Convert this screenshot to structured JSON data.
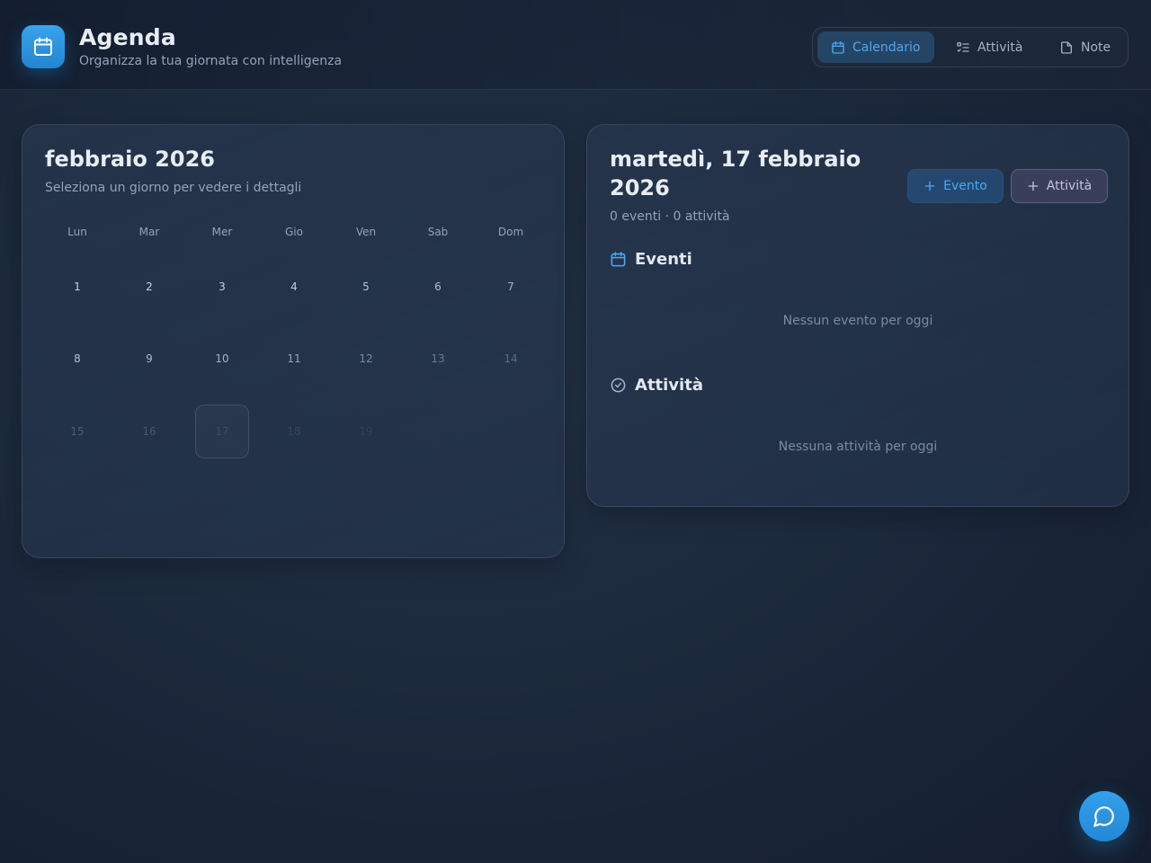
{
  "header": {
    "title": "Agenda",
    "subtitle": "Organizza la tua giornata con intelligenza",
    "icon": "calendar-icon"
  },
  "nav": {
    "tabs": [
      {
        "label": "Calendario",
        "icon": "calendar-icon",
        "active": true
      },
      {
        "label": "Attività",
        "icon": "list-check-icon",
        "active": false
      },
      {
        "label": "Note",
        "icon": "note-icon",
        "active": false
      }
    ]
  },
  "calendar": {
    "month_title": "febbraio 2026",
    "subtitle": "Seleziona un giorno per vedere i dettagli",
    "weekdays": [
      "Lun",
      "Mar",
      "Mer",
      "Gio",
      "Ven",
      "Sab",
      "Dom"
    ],
    "days": [
      "1",
      "2",
      "3",
      "4",
      "5",
      "6",
      "7",
      "8",
      "9",
      "10",
      "11",
      "12",
      "13",
      "14",
      "15",
      "16",
      "17",
      "18",
      "19"
    ],
    "selected_day": "17"
  },
  "day_panel": {
    "title": "martedì, 17 febbraio 2026",
    "counts": "0 eventi · 0 attività",
    "add_event_label": "Evento",
    "add_task_label": "Attività",
    "events_heading": "Eventi",
    "events_empty": "Nessun evento per oggi",
    "tasks_heading": "Attività",
    "tasks_empty": "Nessuna attività per oggi"
  },
  "colors": {
    "accent": "#2f95e4",
    "accent_text": "#4da8ef"
  },
  "fab": {
    "icon": "chat-bubble-icon"
  }
}
